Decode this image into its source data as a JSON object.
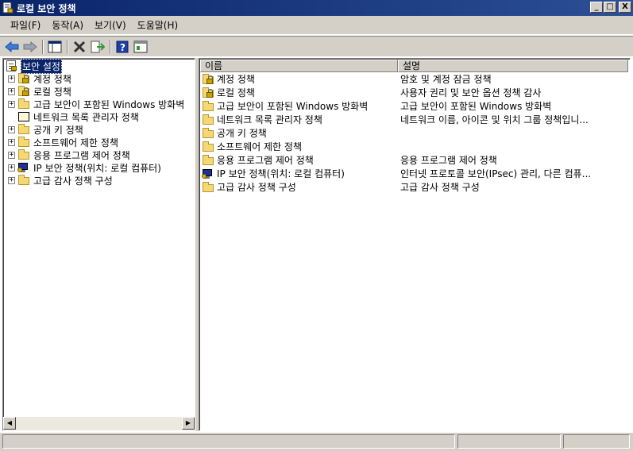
{
  "window": {
    "title": "로컬 보안 정책",
    "controls": {
      "minimize": "_",
      "maximize": "□",
      "close": "X"
    }
  },
  "menu": [
    {
      "label": "파일(F)"
    },
    {
      "label": "동작(A)"
    },
    {
      "label": "보기(V)"
    },
    {
      "label": "도움말(H)"
    }
  ],
  "toolbar": {
    "buttons": [
      "back-icon",
      "forward-icon",
      "show-hide-tree-icon",
      "delete-icon",
      "export-list-icon",
      "help-icon",
      "properties-icon"
    ]
  },
  "tree": {
    "root": {
      "label": "보안 설정",
      "icon": "security-settings-icon"
    },
    "items": [
      {
        "label": "계정 정책",
        "icon": "locked-folder-icon",
        "expandable": true
      },
      {
        "label": "로컬 정책",
        "icon": "locked-folder-icon",
        "expandable": true
      },
      {
        "label": "고급 보안이 포함된 Windows 방화벽",
        "icon": "folder-icon",
        "expandable": true
      },
      {
        "label": "네트워크 목록 관리자 정책",
        "icon": "network-list-icon",
        "expandable": false
      },
      {
        "label": "공개 키 정책",
        "icon": "folder-icon",
        "expandable": true
      },
      {
        "label": "소프트웨어 제한 정책",
        "icon": "folder-icon",
        "expandable": true
      },
      {
        "label": "응용 프로그램 제어 정책",
        "icon": "folder-icon",
        "expandable": true
      },
      {
        "label": "IP 보안 정책(위치: 로컬 컴퓨터)",
        "icon": "ipsec-policy-icon",
        "expandable": true
      },
      {
        "label": "고급 감사 정책 구성",
        "icon": "folder-icon",
        "expandable": true
      }
    ]
  },
  "list": {
    "columns": [
      "이름",
      "설명"
    ],
    "rows": [
      {
        "name": "계정 정책",
        "description": "암호 및 계정 잠금 정책",
        "icon": "locked-folder-icon"
      },
      {
        "name": "로컬 정책",
        "description": "사용자 권리 및 보안 옵션 정책 감사",
        "icon": "locked-folder-icon"
      },
      {
        "name": "고급 보안이 포함된 Windows 방화벽",
        "description": "고급 보안이 포함된 Windows 방화벽",
        "icon": "folder-icon"
      },
      {
        "name": "네트워크 목록 관리자 정책",
        "description": "네트워크 이름, 아이콘 및 위치 그룹 정책입니...",
        "icon": "folder-icon"
      },
      {
        "name": "공개 키 정책",
        "description": "",
        "icon": "folder-icon"
      },
      {
        "name": "소프트웨어 제한 정책",
        "description": "",
        "icon": "folder-icon"
      },
      {
        "name": "응용 프로그램 제어 정책",
        "description": "응용 프로그램 제어 정책",
        "icon": "folder-icon"
      },
      {
        "name": "IP 보안 정책(위치: 로컬 컴퓨터)",
        "description": "인터넷 프로토콜 보안(IPsec) 관리, 다른 컴퓨...",
        "icon": "ipsec-policy-icon"
      },
      {
        "name": "고급 감사 정책 구성",
        "description": "고급 감사 정책 구성",
        "icon": "folder-icon"
      }
    ]
  },
  "colors": {
    "titlebar": "#0a246a",
    "chrome": "#d4d0c8",
    "selection": "#0a246a"
  }
}
